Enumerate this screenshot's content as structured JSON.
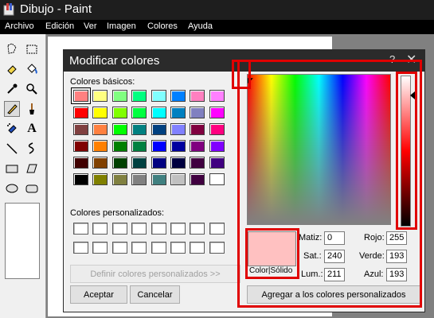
{
  "app": {
    "title": "Dibujo - Paint"
  },
  "menu": [
    "Archivo",
    "Edición",
    "Ver",
    "Imagen",
    "Colores",
    "Ayuda"
  ],
  "dialog": {
    "title": "Modificar colores",
    "help": "?",
    "close": "✕",
    "basic_label": "Colores básicos:",
    "custom_label": "Colores personalizados:",
    "basic_colors": [
      "#ff8080",
      "#ffff80",
      "#80ff80",
      "#00ff80",
      "#80ffff",
      "#0080ff",
      "#ff80c0",
      "#ff80ff",
      "#ff0000",
      "#ffff00",
      "#80ff00",
      "#00ff40",
      "#00ffff",
      "#0080c0",
      "#8080c0",
      "#ff00ff",
      "#804040",
      "#ff8040",
      "#00ff00",
      "#008080",
      "#004080",
      "#8080ff",
      "#800040",
      "#ff0080",
      "#800000",
      "#ff8000",
      "#008000",
      "#008040",
      "#0000ff",
      "#0000a0",
      "#800080",
      "#8000ff",
      "#400000",
      "#804000",
      "#004000",
      "#004040",
      "#000080",
      "#000040",
      "#400040",
      "#400080",
      "#000000",
      "#808000",
      "#808040",
      "#808080",
      "#408080",
      "#c0c0c0",
      "#400040",
      "#ffffff"
    ],
    "define_custom_button": "Definir colores personalizados >>",
    "ok_button": "Aceptar",
    "cancel_button": "Cancelar",
    "preview_label": "Color|Sólido",
    "preview_color": "#ffc1c1",
    "fields": {
      "hue_label": "Matiz:",
      "hue": "0",
      "sat_label": "Sat.:",
      "sat": "240",
      "lum_label": "Lum.:",
      "lum": "211",
      "red_label": "Rojo:",
      "red": "255",
      "green_label": "Verde:",
      "green": "193",
      "blue_label": "Azul:",
      "blue": "193"
    },
    "add_custom_button": "Agregar a los colores personalizados"
  },
  "highlight_color": "#e00000"
}
